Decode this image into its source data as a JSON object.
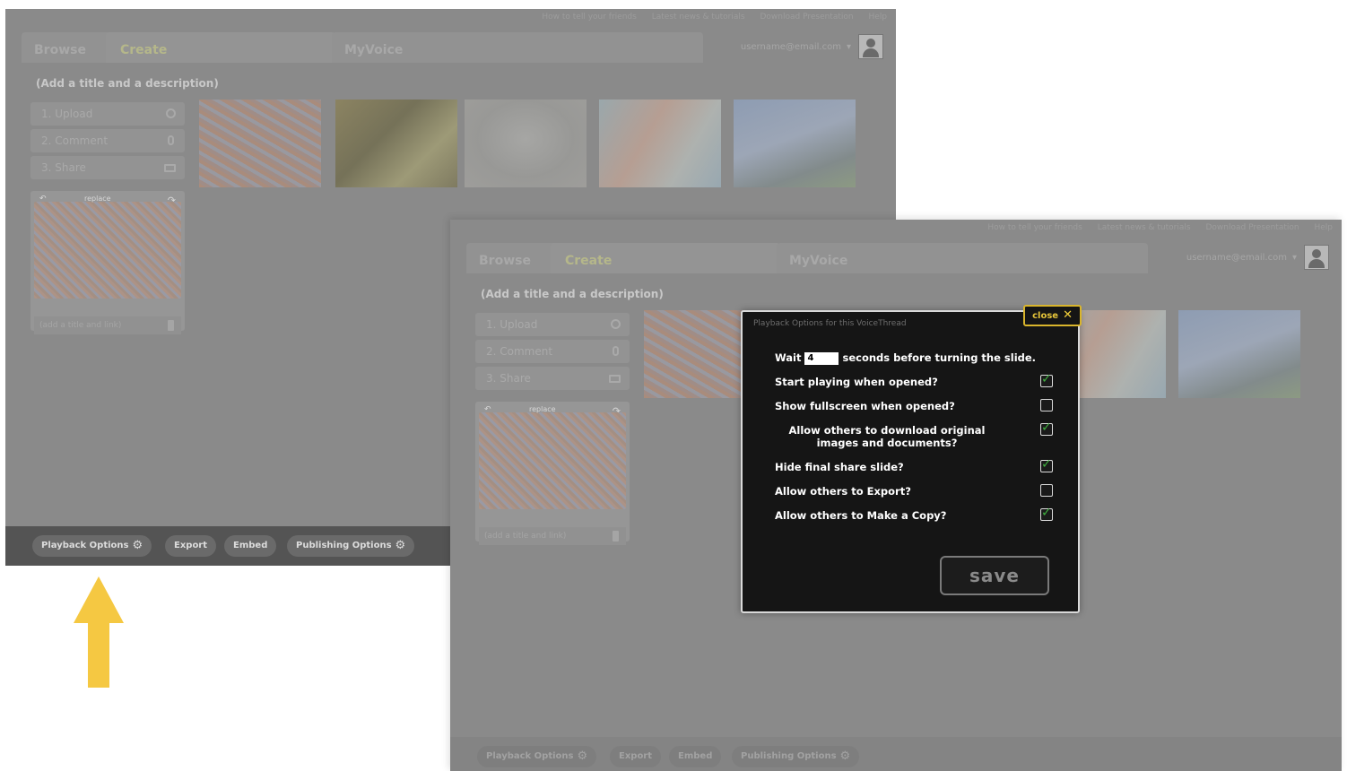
{
  "top_links": [
    "How to tell your friends",
    "Latest news & tutorials",
    "Download Presentation",
    "Help"
  ],
  "tabs": {
    "browse": "Browse",
    "create": "Create",
    "myvoice": "MyVoice"
  },
  "user": {
    "email": "username@email.com",
    "caret": "▾"
  },
  "page": {
    "title_prompt": "(Add a title and a description)"
  },
  "steps": [
    {
      "label": "1. Upload"
    },
    {
      "label": "2. Comment"
    },
    {
      "label": "3. Share"
    }
  ],
  "preview": {
    "replace_label": "replace",
    "caption_placeholder": "(add a title and link)"
  },
  "bottom_bar": {
    "playback_options": "Playback Options",
    "export": "Export",
    "embed": "Embed",
    "publishing_options": "Publishing Options"
  },
  "dialog": {
    "title": "Playback Options for this VoiceThread",
    "close_label": "close",
    "close_glyph": "✕",
    "wait_prefix": "Wait",
    "wait_value": "4",
    "wait_suffix": "seconds before turning the slide.",
    "options": [
      {
        "label": "Start playing when opened?",
        "checked": true
      },
      {
        "label": "Show fullscreen when opened?",
        "checked": false
      },
      {
        "label": "Allow others to download original images and documents?",
        "checked": true
      },
      {
        "label": "Hide final share slide?",
        "checked": true
      },
      {
        "label": "Allow others to Export?",
        "checked": false
      },
      {
        "label": "Allow others to Make a Copy?",
        "checked": true
      }
    ],
    "save_label": "save"
  },
  "colors": {
    "accent_arrow": "#f5c842",
    "check_green": "#3fae3f",
    "close_yellow": "#e6c53a"
  }
}
